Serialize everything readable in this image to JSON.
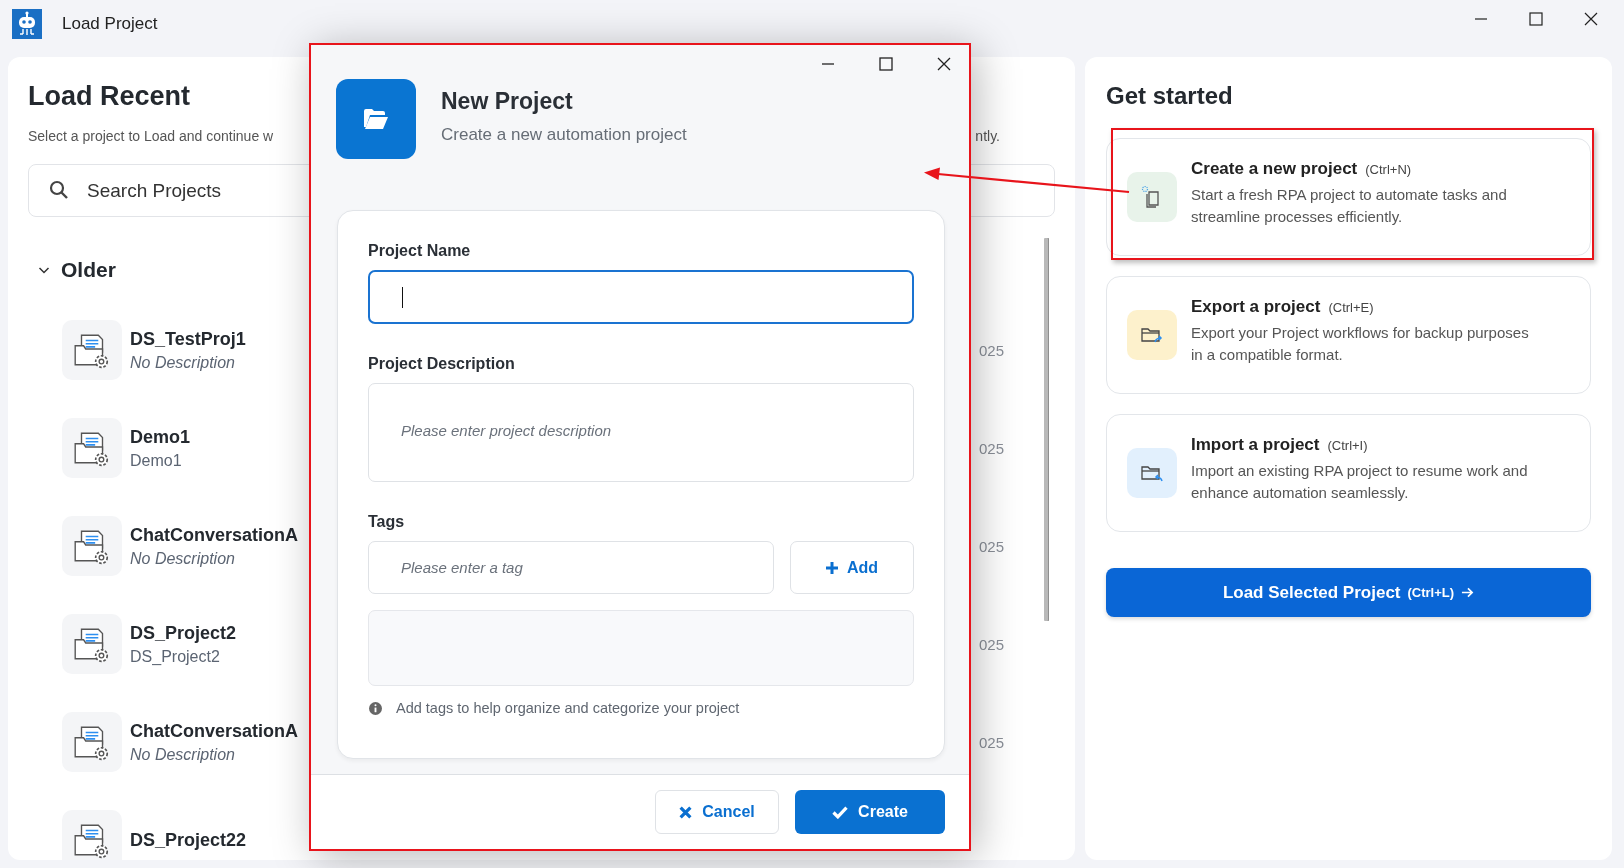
{
  "window": {
    "title": "Load Project"
  },
  "recent": {
    "title": "Load Recent",
    "subtitle_parts": [
      "Select a project to Load and continue w",
      "ntly."
    ],
    "search": {
      "placeholder": "Search Projects"
    },
    "groups": [
      {
        "label": "Older",
        "expanded": true,
        "projects": [
          {
            "name": "DS_TestProj1",
            "description": "No Description",
            "italic": true,
            "date": "025"
          },
          {
            "name": "Demo1",
            "description": "Demo1",
            "italic": false,
            "date": "025"
          },
          {
            "name": "ChatConversationA",
            "description": "No Description",
            "italic": true,
            "date": "025"
          },
          {
            "name": "DS_Project2",
            "description": "DS_Project2",
            "italic": false,
            "date": "025"
          },
          {
            "name": "ChatConversationA",
            "description": "No Description",
            "italic": true,
            "date": "025"
          },
          {
            "name": "DS_Project22"
          }
        ]
      }
    ]
  },
  "get_started": {
    "title": "Get started",
    "actions": [
      {
        "kind": "create",
        "title": "Create a new project",
        "shortcut": "(Ctrl+N)",
        "description": "Start a fresh RPA project to automate tasks and streamline processes efficiently.",
        "highlighted": true
      },
      {
        "kind": "export",
        "title": "Export a project",
        "shortcut": "(Ctrl+E)",
        "description": "Export your Project workflows for backup purposes in a compatible format.",
        "highlighted": false
      },
      {
        "kind": "import",
        "title": "Import a project",
        "shortcut": "(Ctrl+I)",
        "description": "Import an existing RPA project to resume work and enhance automation seamlessly.",
        "highlighted": false
      }
    ],
    "load_button": {
      "label": "Load Selected Project",
      "shortcut": "(Ctrl+L)"
    }
  },
  "dialog": {
    "title": "New Project",
    "subtitle": "Create a new automation project",
    "highlighted": true,
    "name_field": {
      "label": "Project Name",
      "focused": true
    },
    "description_field": {
      "label": "Project Description",
      "placeholder": "Please enter project description"
    },
    "tags": {
      "label": "Tags",
      "placeholder": "Please enter a tag",
      "add_button": "Add",
      "hint": "Add tags to help organize and categorize your project"
    },
    "buttons": [
      {
        "kind": "cancel",
        "label": "Cancel"
      },
      {
        "kind": "create",
        "label": "Create"
      }
    ]
  },
  "annotation_arrow": true
}
